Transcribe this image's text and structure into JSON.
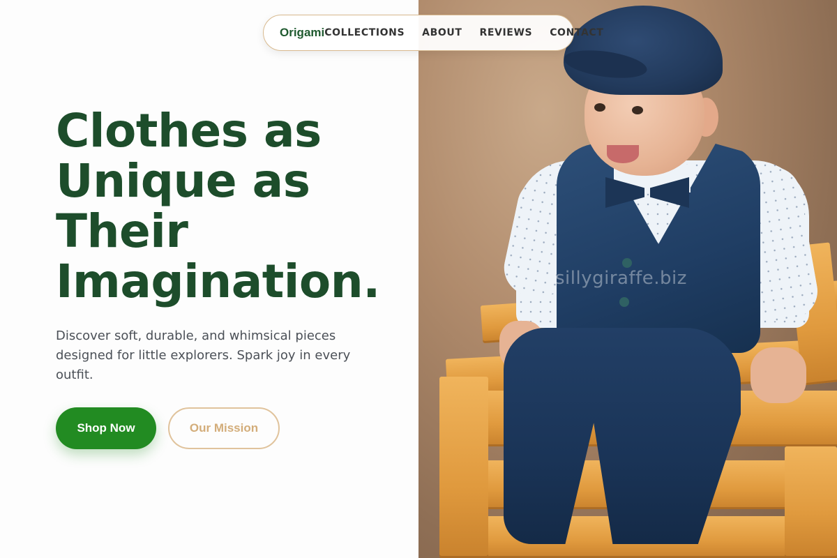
{
  "nav": {
    "brand": "Origami",
    "items": [
      {
        "label": "COLLECTIONS"
      },
      {
        "label": "ABOUT"
      },
      {
        "label": "REVIEWS"
      },
      {
        "label": "CONTACT"
      }
    ]
  },
  "hero": {
    "title_lines": [
      "Clothes as",
      "Unique as",
      "Their",
      "Imagination."
    ],
    "subtitle": "Discover soft, durable, and whimsical pieces designed for little explorers. Spark joy in every outfit.",
    "primary_button": "Shop Now",
    "secondary_button": "Our Mission"
  },
  "image": {
    "watermark": "sillygiraffe.biz"
  },
  "colors": {
    "brand_green": "#1d4d2b",
    "button_green": "#228b22",
    "accent_tan": "#d3ad7a"
  }
}
